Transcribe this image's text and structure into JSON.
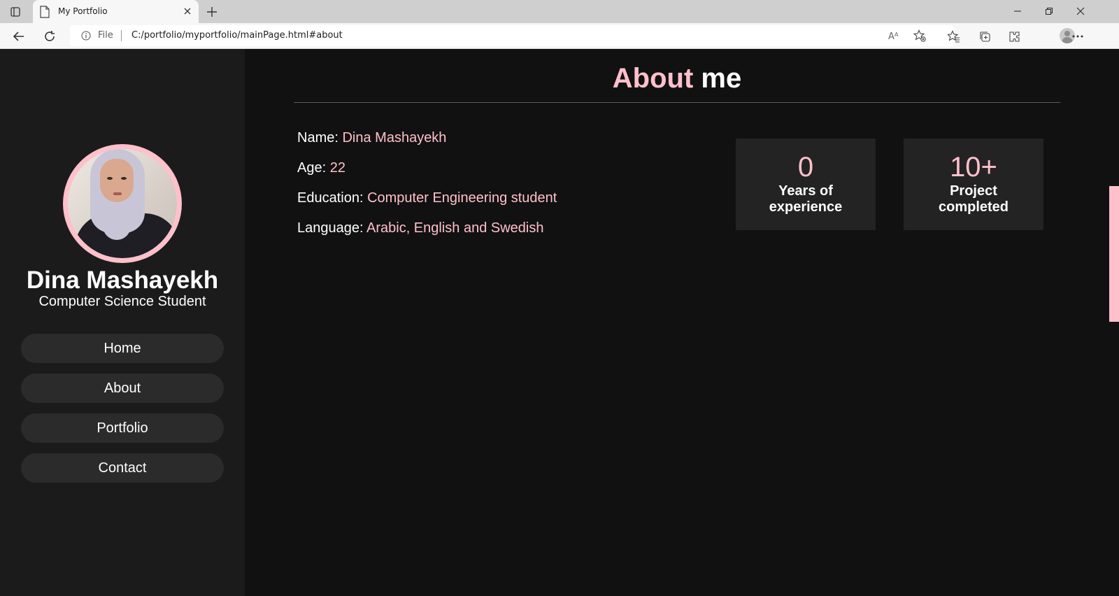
{
  "browser": {
    "tab_title": "My Portfolio",
    "url_scheme": "File",
    "url": "C:/portfolio/myportfolio/mainPage.html#about"
  },
  "sidebar": {
    "name": "Dina Mashayekh",
    "role": "Computer Science Student",
    "nav": [
      {
        "label": "Home"
      },
      {
        "label": "About"
      },
      {
        "label": "Portfolio"
      },
      {
        "label": "Contact"
      }
    ]
  },
  "about": {
    "title_accent": "About",
    "title_rest": "me",
    "info": [
      {
        "label": "Name:",
        "value": "Dina Mashayekh"
      },
      {
        "label": "Age:",
        "value": "22"
      },
      {
        "label": "Education:",
        "value": "Computer Engineering student"
      },
      {
        "label": "Language:",
        "value": "Arabic, English and Swedish"
      }
    ],
    "stats": [
      {
        "number": "0",
        "label": "Years of experience"
      },
      {
        "number": "10+",
        "label": "Project completed"
      }
    ]
  },
  "colors": {
    "accent": "#ffc0cb",
    "page_bg": "#111111",
    "sidebar_bg": "#1b1b1b",
    "card_bg": "#232323"
  }
}
